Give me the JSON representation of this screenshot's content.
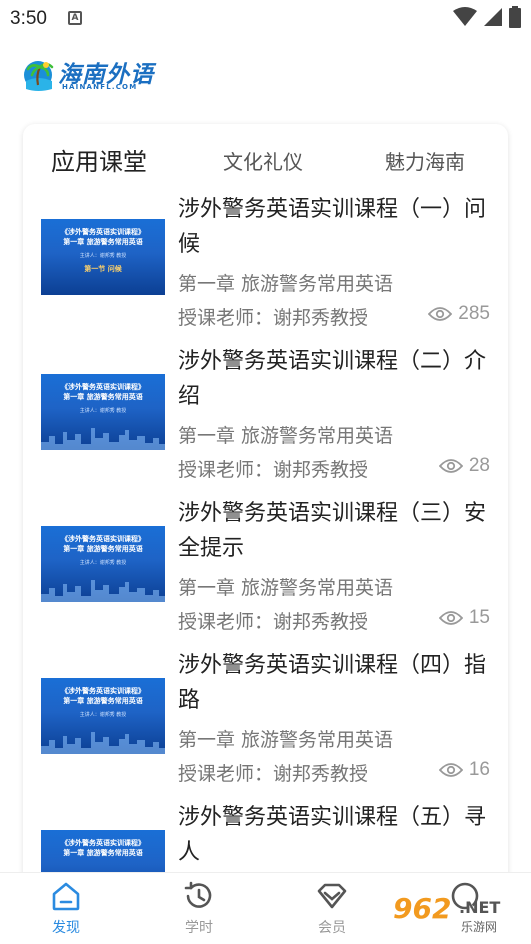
{
  "status_bar": {
    "time": "3:50",
    "notification_glyph": "A"
  },
  "logo": {
    "name": "海南外语",
    "subtitle": "HAINANFL.COM"
  },
  "tabs": [
    {
      "label": "应用课堂",
      "active": true
    },
    {
      "label": "文化礼仪",
      "active": false
    },
    {
      "label": "魅力海南",
      "active": false
    }
  ],
  "courses": [
    {
      "title": "涉外警务英语实训课程（一）问候",
      "chapter": "第一章 旅游警务常用英语",
      "teacher": "授课老师：谢邦秀教授",
      "views": "285",
      "thumb": {
        "t1": "《涉外警务英语实训课程》",
        "t2": "第一章  旅游警务常用英语",
        "t3": "主讲人：谢邦秀 教授",
        "t4": "第一节  问候"
      }
    },
    {
      "title": "涉外警务英语实训课程（二）介绍",
      "chapter": "第一章 旅游警务常用英语",
      "teacher": "授课老师：谢邦秀教授",
      "views": "28",
      "thumb": {
        "t1": "《涉外警务英语实训课程》",
        "t2": "第一章  旅游警务常用英语",
        "t3": "主讲人：谢邦秀 教授",
        "t4": ""
      }
    },
    {
      "title": "涉外警务英语实训课程（三）安全提示",
      "chapter": "第一章 旅游警务常用英语",
      "teacher": "授课老师：谢邦秀教授",
      "views": "15",
      "thumb": {
        "t1": "《涉外警务英语实训课程》",
        "t2": "第一章  旅游警务常用英语",
        "t3": "主讲人：谢邦秀 教授",
        "t4": ""
      }
    },
    {
      "title": "涉外警务英语实训课程（四）指路",
      "chapter": "第一章 旅游警务常用英语",
      "teacher": "授课老师：谢邦秀教授",
      "views": "16",
      "thumb": {
        "t1": "《涉外警务英语实训课程》",
        "t2": "第一章  旅游警务常用英语",
        "t3": "主讲人：谢邦秀 教授",
        "t4": ""
      }
    },
    {
      "title": "涉外警务英语实训课程（五）寻人",
      "chapter": "",
      "teacher": "",
      "views": "",
      "thumb": {
        "t1": "《涉外警务英语实训课程》",
        "t2": "第一章  旅游警务常用英语",
        "t3": "",
        "t4": ""
      }
    }
  ],
  "bottom_nav": [
    {
      "label": "发现",
      "icon": "home-icon",
      "active": true
    },
    {
      "label": "学时",
      "icon": "clock-history-icon",
      "active": false
    },
    {
      "label": "会员",
      "icon": "diamond-icon",
      "active": false
    },
    {
      "label": "",
      "icon": "profile-icon",
      "active": false
    }
  ],
  "watermark": {
    "number": "962",
    "domain": ".NET",
    "text": "乐游网"
  },
  "colors": {
    "accent": "#2b8be0",
    "brand_blue": "#1b6fc1",
    "thumb_blue": "#1a6fd6",
    "watermark_orange": "#f29a1f"
  }
}
